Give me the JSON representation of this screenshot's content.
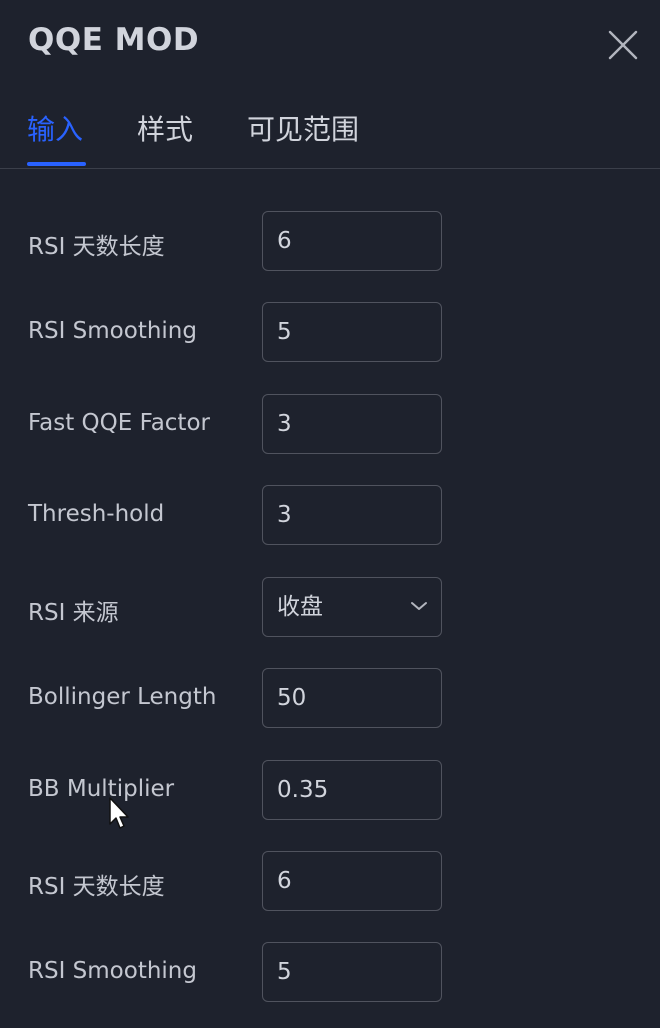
{
  "dialog": {
    "title": "QQE MOD",
    "tabs": [
      {
        "label": "输入",
        "active": true
      },
      {
        "label": "样式",
        "active": false
      },
      {
        "label": "可见范围",
        "active": false
      }
    ]
  },
  "inputs": [
    {
      "label": "RSI 天数长度",
      "value": "6"
    },
    {
      "label": "RSI Smoothing",
      "value": "5"
    },
    {
      "label": "Fast QQE Factor",
      "value": "3"
    },
    {
      "label": "Thresh-hold",
      "value": "3"
    },
    {
      "label": "RSI 来源",
      "value": "收盘",
      "type": "select"
    },
    {
      "label": "Bollinger Length",
      "value": "50"
    },
    {
      "label": "BB Multiplier",
      "value": "0.35"
    },
    {
      "label": "RSI 天数长度",
      "value": "6"
    },
    {
      "label": "RSI Smoothing",
      "value": "5"
    }
  ],
  "icons": {
    "close": "close-icon",
    "dropdown": "chevron-down-icon",
    "cursor": "mouse-pointer-icon"
  },
  "colors": {
    "background": "#1e222d",
    "accent": "#2962ff",
    "text": "#d1d4dc",
    "border": "#50535e"
  }
}
